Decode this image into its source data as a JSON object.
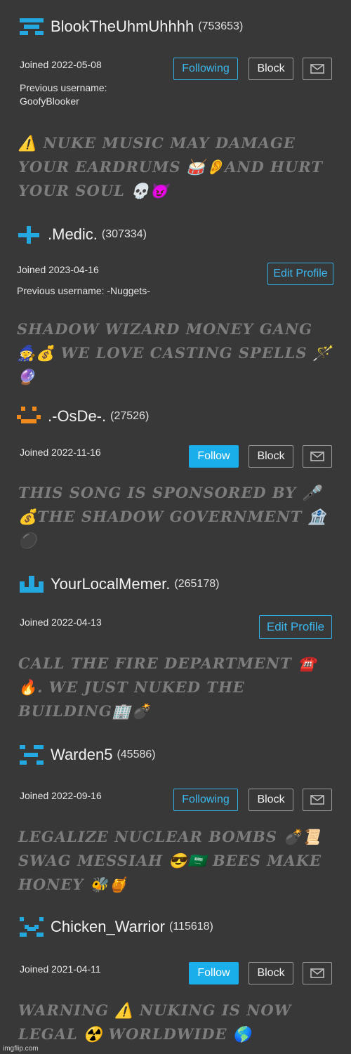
{
  "colors": {
    "background": "#383838",
    "accent": "#1aaeea",
    "status_text": "#7d7d7d",
    "avatar_blue": "#23a8e0",
    "avatar_orange": "#f08a1c"
  },
  "buttons": {
    "following": "Following",
    "follow": "Follow",
    "block": "Block",
    "edit_profile": "Edit Profile",
    "message_icon": "envelope-icon"
  },
  "users": [
    {
      "name": "BlookTheUhmUhhhh",
      "points": "(753653)",
      "joined": "Joined 2022-05-08",
      "prev_label": "Previous username:",
      "prev_name": "GoofyBlooker",
      "status": "⚠️ NUKE MUSIC MAY DAMAGE YOUR EARDRUMS 🥁👂AND HURT YOUR SOUL 💀😈"
    },
    {
      "name": ".Medic.",
      "points": "(307334)",
      "joined": "Joined 2023-04-16",
      "prev": "Previous username: -Nuggets-",
      "status": "SHADOW WIZARD MONEY GANG 🧙💰 WE LOVE CASTING SPELLS 🪄🔮"
    },
    {
      "name": ".-OsDe-.",
      "points": "(27526)",
      "joined": "Joined 2022-11-16",
      "status": "THIS SONG IS SPONSORED BY 🎤💰THE SHADOW GOVERNMENT 🏦⚫"
    },
    {
      "name": "YourLocalMemer.",
      "points": "(265178)",
      "joined": "Joined 2022-04-13",
      "status": "CALL THE FIRE DEPARTMENT ☎️🔥. WE JUST NUKED THE BUILDING🏢💣"
    },
    {
      "name": "Warden5",
      "points": "(45586)",
      "joined": "Joined 2022-09-16",
      "status": "LEGALIZE NUCLEAR BOMBS 💣📜 SWAG MESSIAH 😎🇸🇦 BEES MAKE HONEY 🐝🍯"
    },
    {
      "name": "Chicken_Warrior",
      "points": "(115618)",
      "joined": "Joined 2021-04-11",
      "status": "WARNING ⚠️ NUKING IS NOW LEGAL ☢️ WORLDWIDE 🌎"
    }
  ],
  "footer": "imgflip.com"
}
